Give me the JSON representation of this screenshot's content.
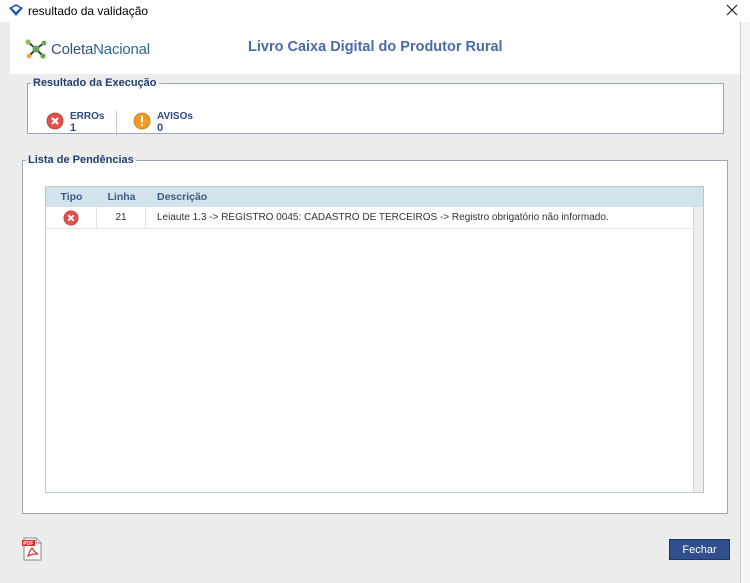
{
  "window": {
    "title": "resultado da validação",
    "app_icon": "diamond-logo-icon",
    "close_icon": "close-icon"
  },
  "header": {
    "logo_text_part1": "Coleta",
    "logo_text_part2": "Nacional",
    "page_title": "Livro Caixa Digital do Produtor Rural"
  },
  "execution": {
    "legend": "Resultado da Execução",
    "errors_label": "ERROs",
    "errors_count": "1",
    "warnings_label": "AVISOs",
    "warnings_count": "0"
  },
  "pending": {
    "legend": "Lista de Pendências",
    "columns": [
      "Tipo",
      "Linha",
      "Descrição"
    ],
    "rows": [
      {
        "tipo_icon": "error-icon",
        "linha": "21",
        "descricao": "Leiaute 1.3 -> REGISTRO 0045: CADASTRO DE TERCEIROS -> Registro obrigatório não informado."
      }
    ]
  },
  "footer": {
    "pdf_icon": "pdf-icon",
    "close_button": "Fechar"
  },
  "colors": {
    "accent": "#2f4f8d",
    "title": "#4a6aa8",
    "error": "#e2514a",
    "warning": "#f29a1f",
    "table_header": "#d3e3ec"
  }
}
